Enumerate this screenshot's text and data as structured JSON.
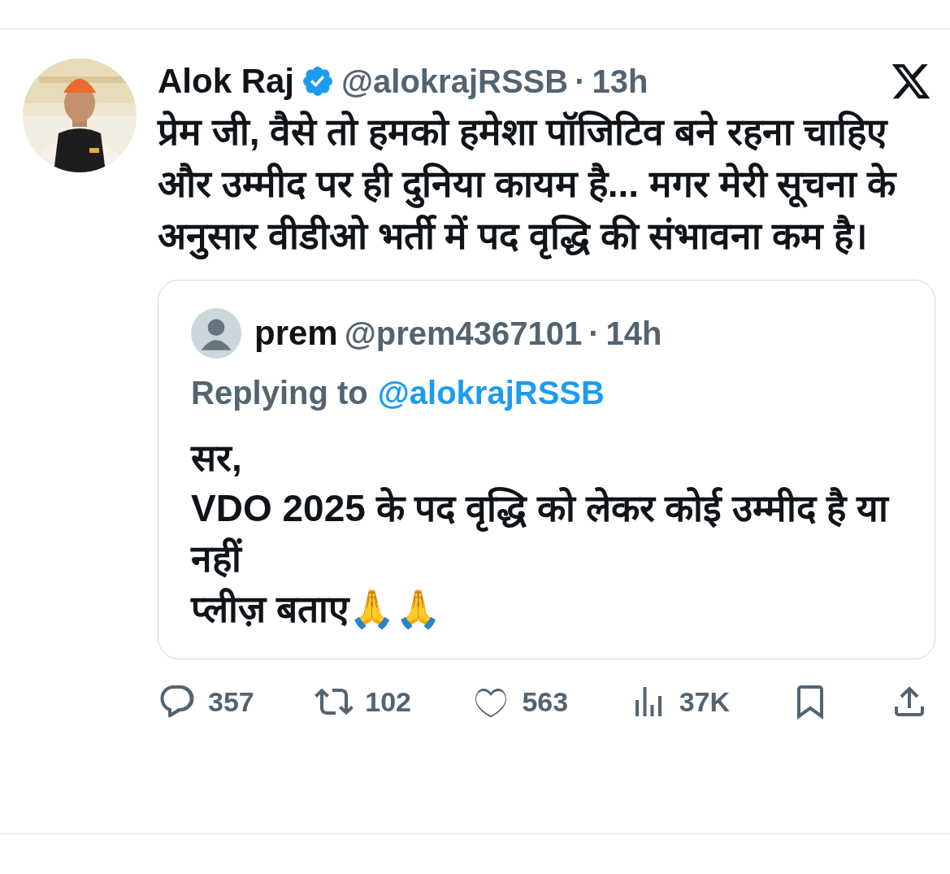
{
  "tweet": {
    "author": {
      "name": "Alok Raj",
      "verified": true,
      "handle": "@alokrajRSSB",
      "separator": "·",
      "time": "13h"
    },
    "text": "प्रेम जी, वैसे तो हमको हमेशा पॉजिटिव बने रहना चाहिए और उम्मीद पर ही दुनिया कायम है... मगर मेरी सूचना के अनुसार वीडीओ भर्ती में पद वृद्धि की संभावना कम है।",
    "quoted": {
      "name": "prem",
      "handle": "@prem4367101",
      "separator": "·",
      "time": "14h",
      "replying_label": "Replying to",
      "replying_to": "@alokrajRSSB",
      "lines": [
        "सर,",
        "VDO 2025 के पद वृद्धि को लेकर  कोई उम्मीद है या नहीं",
        "प्लीज़ बताए🙏🙏"
      ]
    },
    "actions": [
      {
        "kind": "reply",
        "count": "357"
      },
      {
        "kind": "repost",
        "count": "102"
      },
      {
        "kind": "like",
        "count": "563"
      },
      {
        "kind": "views",
        "count": "37K"
      },
      {
        "kind": "bookmark"
      },
      {
        "kind": "share"
      }
    ]
  }
}
